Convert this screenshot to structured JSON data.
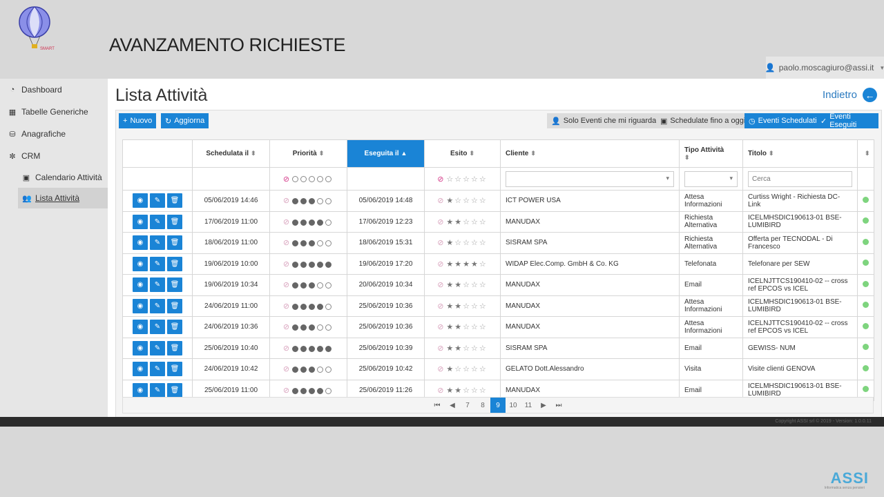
{
  "slide": {
    "title": "AVANZAMENTO RICHIESTE",
    "logo_text": "SMART"
  },
  "user": {
    "email": "paolo.moscagiuro@assi.it"
  },
  "sidebar": {
    "items": [
      {
        "label": "Dashboard",
        "icon": "dashboard-icon"
      },
      {
        "label": "Tabelle Generiche",
        "icon": "table-icon"
      },
      {
        "label": "Anagrafiche",
        "icon": "database-icon"
      },
      {
        "label": "CRM",
        "icon": "handshake-icon"
      },
      {
        "label": "Calendario Attività",
        "icon": "calendar-icon"
      },
      {
        "label": "Lista Attività",
        "icon": "users-icon"
      }
    ]
  },
  "page": {
    "title": "Lista Attività",
    "back_label": "Indietro"
  },
  "toolbar": {
    "new_label": "Nuovo",
    "refresh_label": "Aggiorna",
    "filter_mine_label": "Solo Eventi che mi riguardano",
    "filter_until_today_label": "Schedulate fino a oggi",
    "scheduled_label": "Eventi Schedulati",
    "executed_label": "Eventi Eseguiti"
  },
  "table": {
    "headers": {
      "scheduled": "Schedulata il",
      "priority": "Priorità",
      "executed": "Eseguita il",
      "outcome": "Esito",
      "client": "Cliente",
      "type": "Tipo Attività",
      "title": "Titolo"
    },
    "search_placeholder": "Cerca",
    "rows": [
      {
        "scheduled": "05/06/2019 14:46",
        "priority": 3,
        "executed": "05/06/2019 14:48",
        "outcome": 1,
        "client": "ICT POWER USA",
        "type": "Attesa Informazioni",
        "title": "Curtiss Wright - Richiesta DC-Link"
      },
      {
        "scheduled": "17/06/2019 11:00",
        "priority": 4,
        "executed": "17/06/2019 12:23",
        "outcome": 2,
        "client": "MANUDAX",
        "type": "Richiesta Alternativa",
        "title": "ICELMHSDIC190613-01 BSE-LUMIBIRD"
      },
      {
        "scheduled": "18/06/2019 11:00",
        "priority": 3,
        "executed": "18/06/2019 15:31",
        "outcome": 1,
        "client": "SISRAM SPA",
        "type": "Richiesta Alternativa",
        "title": "Offerta per TECNODAL - Di Francesco"
      },
      {
        "scheduled": "19/06/2019 10:00",
        "priority": 5,
        "executed": "19/06/2019 17:20",
        "outcome": 4,
        "client": "WIDAP Elec.Comp. GmbH & Co. KG",
        "type": "Telefonata",
        "title": "Telefonare per SEW"
      },
      {
        "scheduled": "19/06/2019 10:34",
        "priority": 3,
        "executed": "20/06/2019 10:34",
        "outcome": 2,
        "client": "MANUDAX",
        "type": "Email",
        "title": "ICELNJTTCS190410-02 -- cross ref EPCOS vs ICEL"
      },
      {
        "scheduled": "24/06/2019 11:00",
        "priority": 4,
        "executed": "25/06/2019 10:36",
        "outcome": 2,
        "client": "MANUDAX",
        "type": "Attesa Informazioni",
        "title": "ICELMHSDIC190613-01 BSE-LUMIBIRD"
      },
      {
        "scheduled": "24/06/2019 10:36",
        "priority": 3,
        "executed": "25/06/2019 10:36",
        "outcome": 2,
        "client": "MANUDAX",
        "type": "Attesa Informazioni",
        "title": "ICELNJTTCS190410-02 -- cross ref EPCOS vs ICEL"
      },
      {
        "scheduled": "25/06/2019 10:40",
        "priority": 5,
        "executed": "25/06/2019 10:39",
        "outcome": 2,
        "client": "SISRAM SPA",
        "type": "Email",
        "title": "GEWISS- NUM"
      },
      {
        "scheduled": "24/06/2019 10:42",
        "priority": 3,
        "executed": "25/06/2019 10:42",
        "outcome": 1,
        "client": "GELATO Dott.Alessandro",
        "type": "Visita",
        "title": "Visite clienti GENOVA"
      },
      {
        "scheduled": "25/06/2019 11:00",
        "priority": 4,
        "executed": "25/06/2019 11:26",
        "outcome": 2,
        "client": "MANUDAX",
        "type": "Email",
        "title": "ICELMHSDIC190613-01 BSE-LUMIBIRD"
      }
    ]
  },
  "pager": {
    "pages": [
      "7",
      "8",
      "9",
      "10",
      "11"
    ],
    "current": "9"
  },
  "footer": {
    "copyright": "Copyright ASSI srl © 2019 - Version: 1.0.0.11"
  },
  "brand": {
    "name": "ASSI",
    "tagline": "Informatica senza pensieri"
  },
  "colors": {
    "accent": "#1a84d6",
    "status_ok": "#7ed47e",
    "ban": "#d53a8a"
  }
}
